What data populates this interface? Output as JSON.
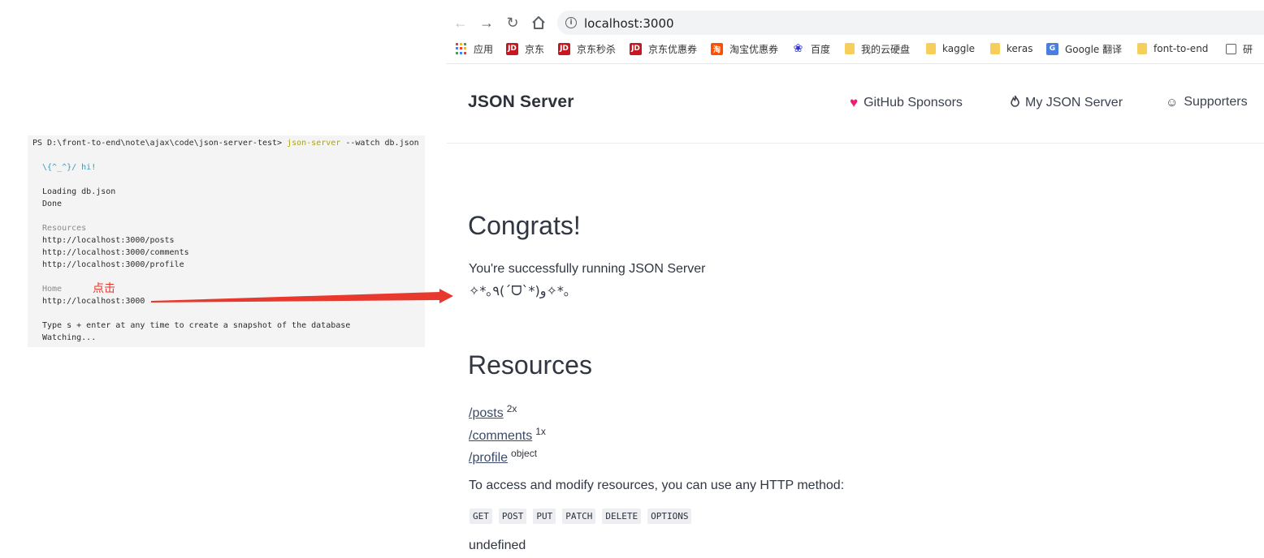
{
  "terminal": {
    "prompt": "PS D:\\front-to-end\\note\\ajax\\code\\json-server-test>",
    "command": "json-server",
    "command_args": "--watch db.json",
    "hi": "\\{^_^}/ hi!",
    "loading": "Loading db.json",
    "done": "Done",
    "resources_heading": "Resources",
    "resource_urls": [
      "http://localhost:3000/posts",
      "http://localhost:3000/comments",
      "http://localhost:3000/profile"
    ],
    "home_heading": "Home",
    "home_url": "http://localhost:3000",
    "snapshot_hint": "Type s + enter at any time to create a snapshot of the database",
    "watching": "Watching...",
    "annotation": "点击"
  },
  "browser": {
    "url": "localhost:3000",
    "bookmarks": [
      {
        "label": "应用",
        "icon": "apps-grid-icon"
      },
      {
        "label": "京东",
        "icon": "jd-icon"
      },
      {
        "label": "京东秒杀",
        "icon": "jd-icon"
      },
      {
        "label": "京东优惠券",
        "icon": "jd-icon"
      },
      {
        "label": "淘宝优惠券",
        "icon": "taobao-icon"
      },
      {
        "label": "百度",
        "icon": "baidu-paw-icon"
      },
      {
        "label": "我的云硬盘",
        "icon": "folder-icon"
      },
      {
        "label": "kaggle",
        "icon": "folder-icon"
      },
      {
        "label": "keras",
        "icon": "folder-icon"
      },
      {
        "label": "Google 翻译",
        "icon": "google-translate-icon"
      },
      {
        "label": "font-to-end",
        "icon": "folder-icon"
      },
      {
        "label": "研",
        "icon": "globe-icon"
      }
    ],
    "jd_icon_text": "JD",
    "taobao_icon_text": "淘",
    "gt_icon_text": "G"
  },
  "site": {
    "brand": "JSON Server",
    "nav": [
      {
        "label": "GitHub Sponsors",
        "icon": "heart-icon"
      },
      {
        "label": "My JSON Server",
        "icon": "fire-icon"
      },
      {
        "label": "Supporters",
        "icon": "smile-icon"
      }
    ],
    "congrats_title": "Congrats!",
    "running_text": "You're successfully running JSON Server",
    "kaomoji": "✧*｡٩(ˊᗜˋ*)و✧*｡",
    "resources_title": "Resources",
    "resources": [
      {
        "path": "/posts",
        "badge": "2x"
      },
      {
        "path": "/comments",
        "badge": "1x"
      },
      {
        "path": "/profile",
        "badge": "object"
      }
    ],
    "access_text": "To access and modify resources, you can use any HTTP method:",
    "methods": [
      "GET",
      "POST",
      "PUT",
      "PATCH",
      "DELETE",
      "OPTIONS"
    ],
    "footer_text": "undefined"
  }
}
